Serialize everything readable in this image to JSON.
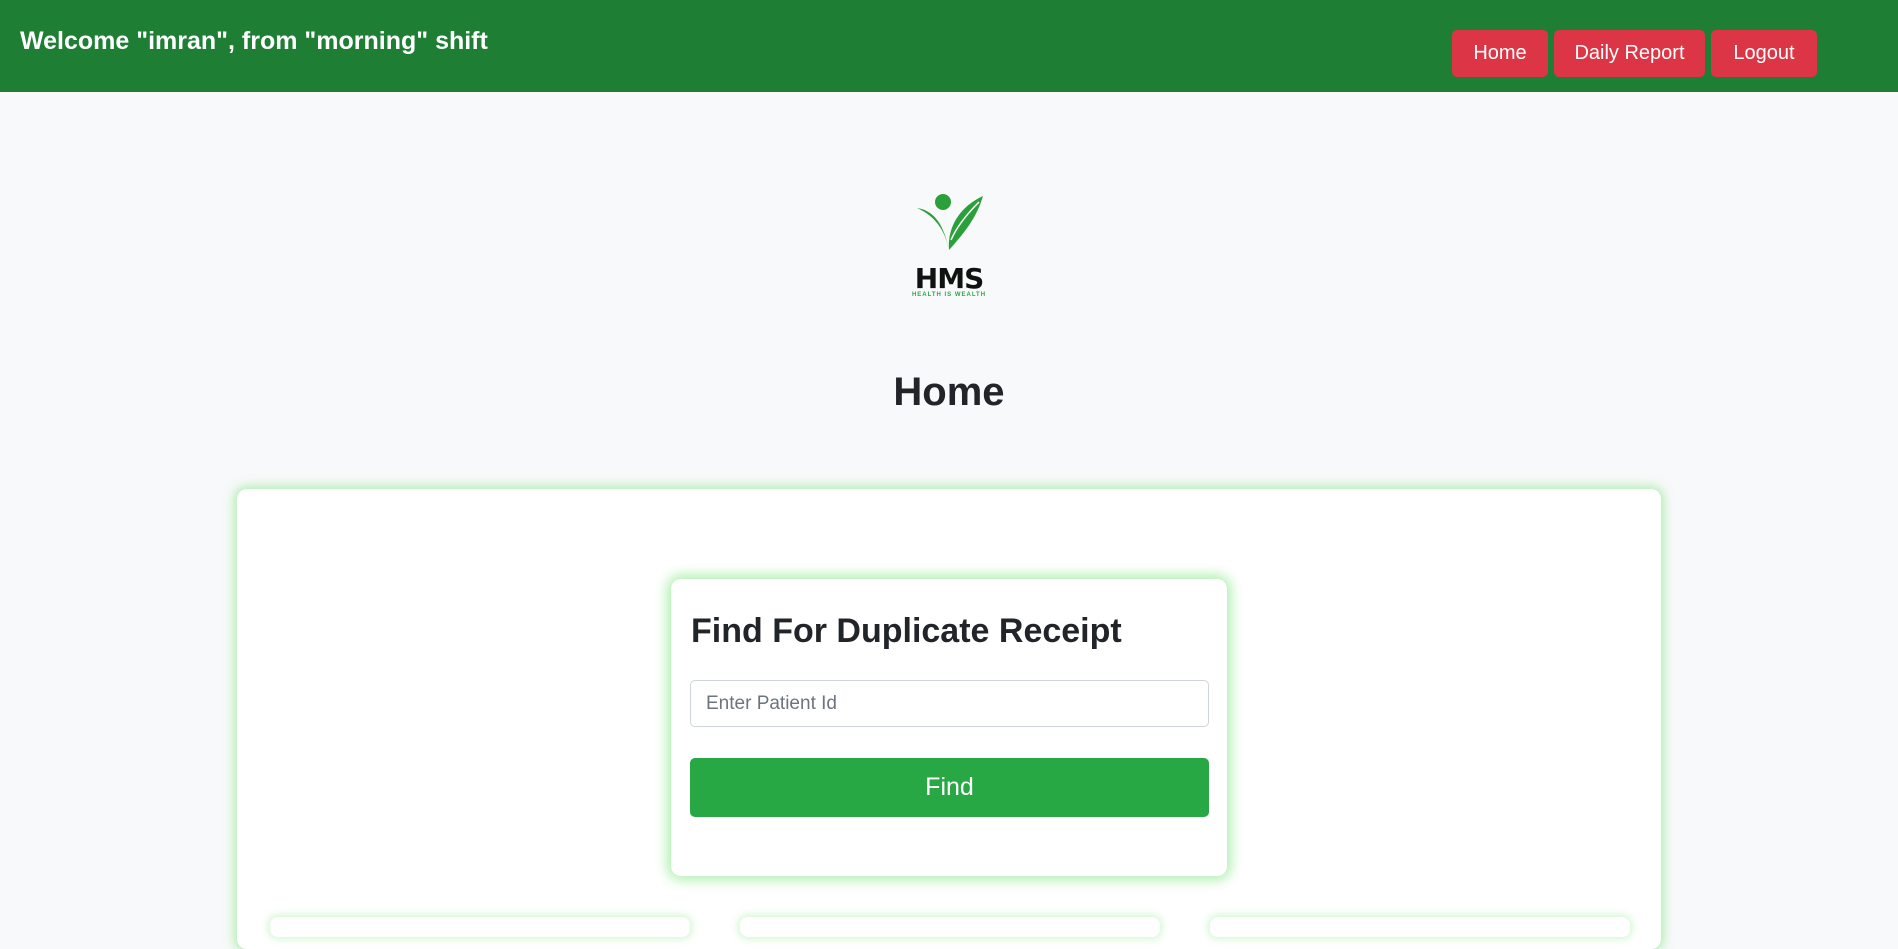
{
  "header": {
    "welcome_text": "Welcome \"imran\", from \"morning\" shift",
    "nav": [
      {
        "label": "Home"
      },
      {
        "label": "Daily Report"
      },
      {
        "label": "Logout"
      }
    ]
  },
  "logo": {
    "text": "HMS",
    "tagline": "HEALTH IS WEALTH"
  },
  "main": {
    "title": "Home",
    "duplicate_receipt": {
      "title": "Find For Duplicate Receipt",
      "input_placeholder": "Enter Patient Id",
      "input_value": "",
      "button_label": "Find"
    }
  },
  "colors": {
    "header_bg": "#1e7e34",
    "nav_button": "#dc3545",
    "primary_button": "#28a745",
    "page_bg": "#f8f9fa"
  }
}
